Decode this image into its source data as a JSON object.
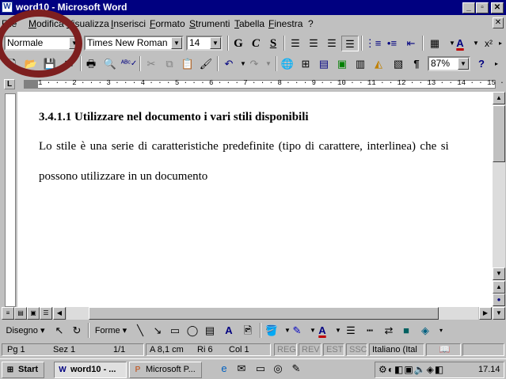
{
  "window": {
    "title": "word10 - Microsoft Word",
    "app_icon": "W"
  },
  "menu": [
    "File",
    "Modifica",
    "Visualizza",
    "Inserisci",
    "Formato",
    "Strumenti",
    "Tabella",
    "Finestra",
    "?"
  ],
  "formatting": {
    "style": "Normale",
    "font": "Times New Roman",
    "size": "14",
    "bold": "G",
    "italic": "C",
    "underline": "S"
  },
  "standard": {
    "zoom": "87%"
  },
  "ruler": {
    "numbers": "1 · · · 2 · · · 3 · · · 4 · · · 5 · · · 6 · · · 7 · · · 8 · · · 9 · · 10 · · 11 · · 12 · · 13 · · 14 · · 15 · · 16"
  },
  "document": {
    "heading": "3.4.1.1 Utilizzare nel documento i vari stili disponibili",
    "line1": "Lo stile è una serie di caratteristiche predefinite (tipo di carattere, interlinea) che si",
    "line2": "possono utilizzare in un documento"
  },
  "drawing": {
    "draw_label": "Disegno",
    "shapes_label": "Forme"
  },
  "status": {
    "page": "Pg 1",
    "section": "Sez 1",
    "page_of": "1/1",
    "at": "A 8,1 cm",
    "line": "Ri 6",
    "col": "Col 1",
    "rec": "REG",
    "rev": "REV",
    "ext": "EST",
    "ovr": "SSC",
    "lang": "Italiano (Ital"
  },
  "taskbar": {
    "start": "Start",
    "tasks": [
      "word10 - ...",
      "Microsoft P..."
    ],
    "clock": "17.14"
  },
  "colors": {
    "title_bg": "#000080",
    "annotation": "#7d1f1f",
    "face": "#c0c0c0"
  }
}
